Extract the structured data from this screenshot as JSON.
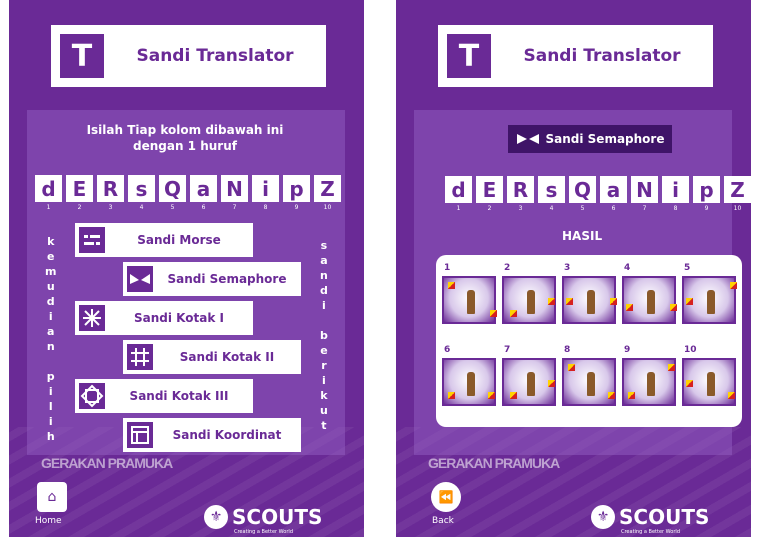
{
  "left": {
    "title": "Sandi Translator",
    "logo_letter": "T",
    "instruction": "Isilah Tiap kolom dibawah ini dengan 1 huruf",
    "letters": [
      "d",
      "E",
      "R",
      "s",
      "Q",
      "a",
      "N",
      "i",
      "p",
      "Z"
    ],
    "numbers": [
      "1",
      "2",
      "3",
      "4",
      "5",
      "6",
      "7",
      "8",
      "9",
      "10"
    ],
    "vertical_left": [
      "k",
      "e",
      "m",
      "u",
      "d",
      "i",
      "a",
      "n",
      "",
      "p",
      "i",
      "l",
      "i",
      "h"
    ],
    "vertical_right": [
      "s",
      "a",
      "n",
      "d",
      "i",
      "",
      "b",
      "e",
      "r",
      "i",
      "k",
      "u",
      "t"
    ],
    "menu": [
      {
        "label": "Sandi Morse",
        "icon": "morse-icon"
      },
      {
        "label": "Sandi Semaphore",
        "icon": "semaphore-flags-icon"
      },
      {
        "label": "Sandi Kotak I",
        "icon": "kotak-i-icon"
      },
      {
        "label": "Sandi Kotak II",
        "icon": "kotak-ii-grid-icon"
      },
      {
        "label": "Sandi Kotak III",
        "icon": "kotak-iii-icon"
      },
      {
        "label": "Sandi Koordinat",
        "icon": "koordinat-icon"
      }
    ],
    "brand": "GERAKAN PRAMUKA",
    "home_label": "Home",
    "scouts_text": "SCOUTS",
    "scouts_sub": "Creating a Better World"
  },
  "right": {
    "title": "Sandi Translator",
    "logo_letter": "T",
    "badge": "Sandi Semaphore",
    "letters": [
      "d",
      "E",
      "R",
      "s",
      "Q",
      "a",
      "N",
      "i",
      "p",
      "Z"
    ],
    "numbers": [
      "1",
      "2",
      "3",
      "4",
      "5",
      "6",
      "7",
      "8",
      "9",
      "10"
    ],
    "hasil": "HASIL",
    "results": [
      {
        "n": "1",
        "pose": "left-up"
      },
      {
        "n": "2",
        "pose": "right-out-left-down"
      },
      {
        "n": "3",
        "pose": "both-out"
      },
      {
        "n": "4",
        "pose": "both-out-low"
      },
      {
        "n": "5",
        "pose": "right-up-left-out"
      },
      {
        "n": "6",
        "pose": "both-down"
      },
      {
        "n": "7",
        "pose": "right-out-left-down"
      },
      {
        "n": "8",
        "pose": "left-up-right-down"
      },
      {
        "n": "9",
        "pose": "right-up-left-down"
      },
      {
        "n": "10",
        "pose": "left-out-right-down"
      }
    ],
    "brand": "GERAKAN PRAMUKA",
    "back_label": "Back",
    "scouts_text": "SCOUTS",
    "scouts_sub": "Creating a Better World"
  },
  "colors": {
    "accent": "#6a2a96",
    "dark": "#3f1468",
    "flag_yellow": "#ffd200",
    "flag_red": "#d62020"
  }
}
